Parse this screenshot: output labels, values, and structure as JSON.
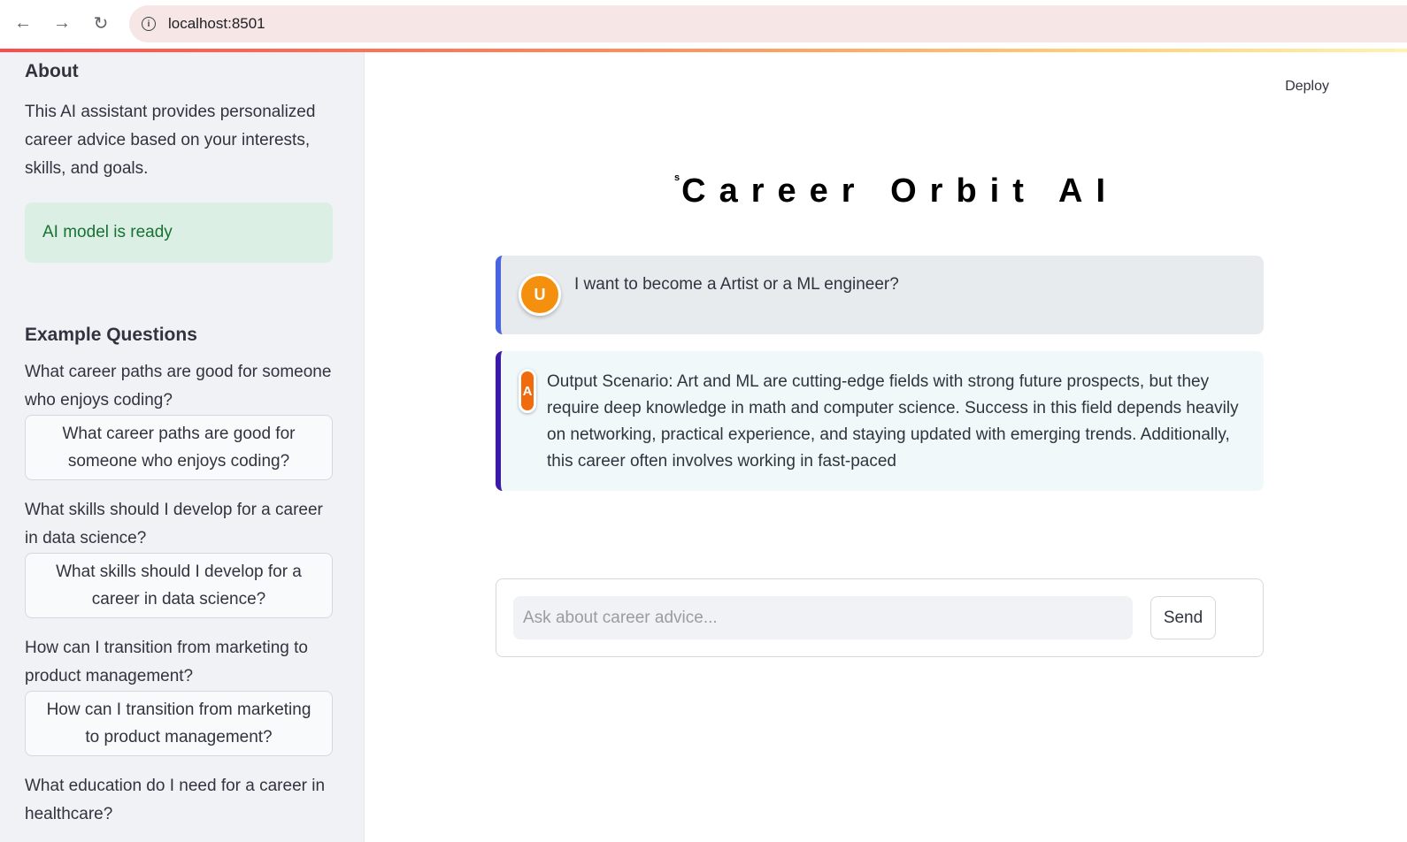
{
  "browser": {
    "url": "localhost:8501",
    "back_icon": "arrow-left-icon",
    "forward_icon": "arrow-right-icon",
    "reload_icon": "reload-icon",
    "site_info_icon": "info-icon"
  },
  "header": {
    "deploy_label": "Deploy"
  },
  "sidebar": {
    "about_heading": "About",
    "about_text": "This AI assistant provides personalized career advice based on your interests, skills, and goals.",
    "status_text": "AI model is ready",
    "examples_heading": "Example Questions",
    "examples": [
      {
        "text": "What career paths are good for someone who enjoys coding?",
        "button": "What career paths are good for someone who enjoys coding?"
      },
      {
        "text": "What skills should I develop for a career in data science?",
        "button": "What skills should I develop for a career in data science?"
      },
      {
        "text": "How can I transition from marketing to product management?",
        "button": "How can I transition from marketing to product management?"
      },
      {
        "text": "What education do I need for a career in healthcare?"
      }
    ]
  },
  "main": {
    "title_prefix": "s",
    "title": "Career Orbit AI",
    "messages": [
      {
        "role": "user",
        "avatar": "U",
        "text": "I want to become a Artist or a ML engineer?"
      },
      {
        "role": "assistant",
        "avatar": "A",
        "text": "Output Scenario: Art and ML are cutting-edge fields with strong future prospects, but they require deep knowledge in math and computer science. Success in this field depends heavily on networking, practical experience, and staying updated with emerging trends. Additionally, this career often involves working in fast-paced"
      }
    ],
    "input_placeholder": "Ask about career advice...",
    "send_label": "Send"
  },
  "colors": {
    "sidebar_bg": "#f0f2f6",
    "status_bg": "#dcefe4",
    "status_text": "#177233",
    "user_accent": "#4a63e0",
    "assistant_accent": "#3b1aa6",
    "user_avatar": "#f5900f",
    "assistant_avatar": "#f16a0c"
  }
}
